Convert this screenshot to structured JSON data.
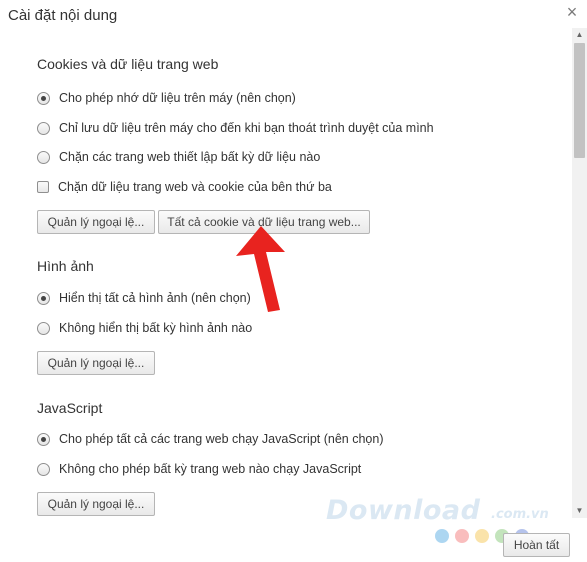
{
  "dialog": {
    "title": "Cài đặt nội dung",
    "close_glyph": "×",
    "done_label": "Hoàn tất"
  },
  "cookies": {
    "title": "Cookies và dữ liệu trang web",
    "options": [
      "Cho phép nhớ dữ liệu trên máy (nên chọn)",
      "Chỉ lưu dữ liệu trên máy cho đến khi bạn thoát trình duyệt của mình",
      "Chặn các trang web thiết lập bất kỳ dữ liệu nào"
    ],
    "selected_index": 0,
    "block_third_party_label": "Chặn dữ liệu trang web và cookie của bên thứ ba",
    "block_third_party_checked": false,
    "manage_exceptions_label": "Quản lý ngoại lệ...",
    "all_cookies_label": "Tất cả cookie và dữ liệu trang web..."
  },
  "images": {
    "title": "Hình ảnh",
    "options": [
      "Hiển thị tất cả hình ảnh (nên chọn)",
      "Không hiển thị bất kỳ hình ảnh nào"
    ],
    "selected_index": 0,
    "manage_exceptions_label": "Quản lý ngoại lệ..."
  },
  "javascript": {
    "title": "JavaScript",
    "options": [
      "Cho phép tất cả các trang web chạy JavaScript (nên chọn)",
      "Không cho phép bất kỳ trang web nào chạy JavaScript"
    ],
    "selected_index": 0,
    "manage_exceptions_label": "Quản lý ngoại lệ..."
  },
  "scrollbar": {
    "up_glyph": "▲",
    "down_glyph": "▼"
  },
  "annotation": {
    "arrow_color": "#e8231f"
  },
  "watermark": {
    "text": "Download",
    "suffix": ".com.vn",
    "dot_colors": [
      "#4aa3df",
      "#f26d6d",
      "#f5c242",
      "#7ac36a",
      "#5b7bd5"
    ]
  }
}
